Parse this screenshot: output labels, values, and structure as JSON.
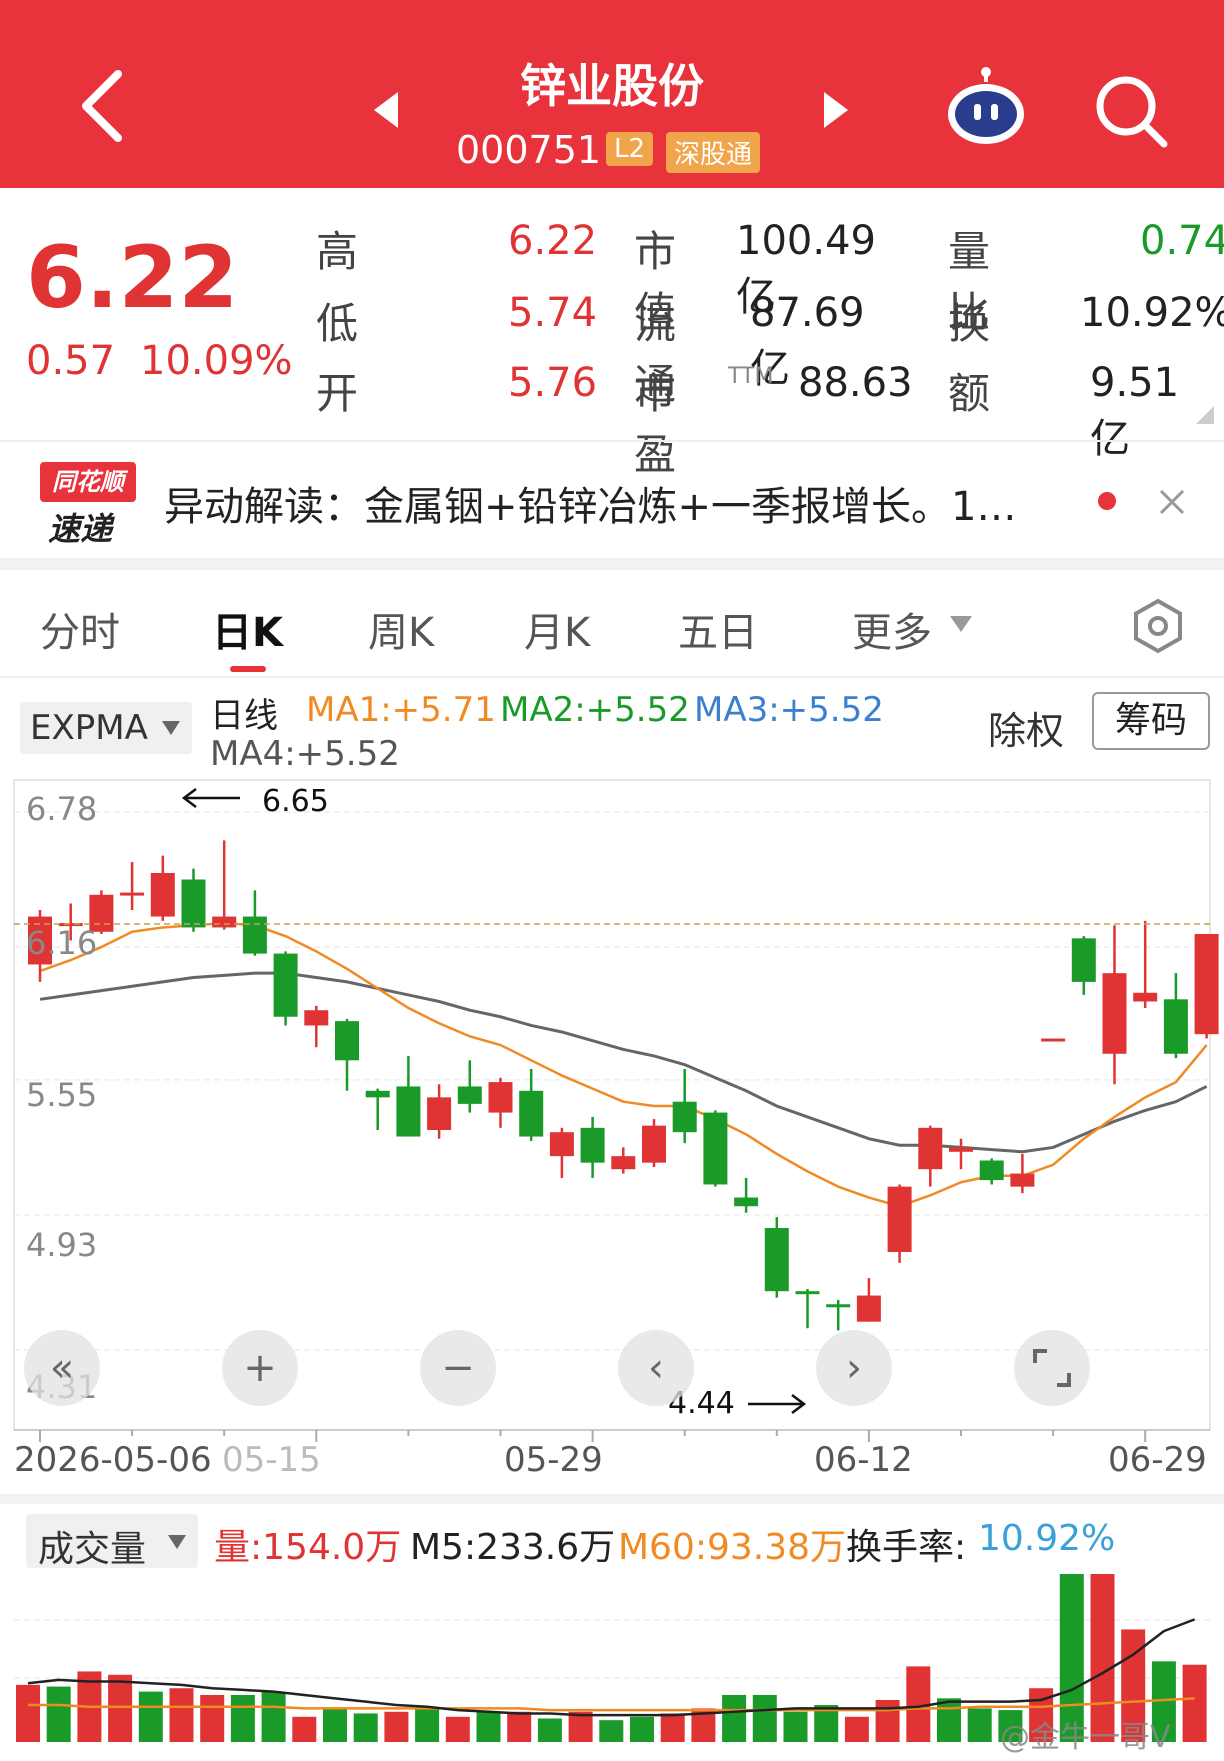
{
  "header": {
    "title": "锌业股份",
    "code": "000751",
    "badge_l2": "L2",
    "badge_connect": "深股通"
  },
  "quote": {
    "price": "6.22",
    "change": "0.57",
    "change_pct": "10.09%",
    "rows": [
      {
        "l1": "高",
        "v1": "6.22",
        "l2": "市值",
        "v2": "100.49亿",
        "l3": "量比",
        "v3": "0.74"
      },
      {
        "l1": "低",
        "v1": "5.74",
        "l2": "流通",
        "v2": "87.69亿",
        "l3": "换",
        "v3": "10.92%"
      },
      {
        "l1": "开",
        "v1": "5.76",
        "l2": "市盈",
        "v2": "88.63",
        "l3": "额",
        "v3": "9.51亿"
      }
    ],
    "pe_sup": "TTM"
  },
  "news": {
    "logo_top": "同花顺",
    "logo_bottom": "速递",
    "text": "异动解读：金属铟+铅锌冶炼+一季报增长。1…"
  },
  "tabs": [
    "分时",
    "日K",
    "周K",
    "月K",
    "五日",
    "更多"
  ],
  "active_tab": "日K",
  "indicator": {
    "selector": "EXPMA",
    "line_label": "日线",
    "ma1": "MA1:+5.71",
    "ma2": "MA2:+5.52",
    "ma3": "MA3:+5.52",
    "ma4": "MA4:+5.52",
    "exright": "除权",
    "chip": "筹码"
  },
  "annotations": {
    "high": "6.65",
    "low": "4.44"
  },
  "volume": {
    "selector": "成交量",
    "vol": "量:154.0万",
    "m5": "M5:233.6万",
    "m60": "M60:93.38万",
    "turnover_label": "换手率:",
    "turnover_value": "10.92%"
  },
  "watermark": "@金牛一哥V",
  "colors": {
    "header": "#e8323c",
    "up": "#e03434",
    "down": "#1a9a28",
    "ma1": "#f08a24",
    "ma2": "#1a9a28",
    "ma3": "#3a7fd0"
  },
  "chart_data": {
    "type": "candlestick",
    "ylim": [
      4.31,
      6.78
    ],
    "yticks": [
      "6.78",
      "6.16",
      "5.55",
      "4.93",
      "4.31"
    ],
    "xticks": [
      "2026-05-06",
      "05-15",
      "05-29",
      "06-12",
      "06-29"
    ],
    "candles": [
      {
        "o": 6.08,
        "c": 6.3,
        "h": 6.33,
        "l": 6.0
      },
      {
        "o": 6.26,
        "c": 6.27,
        "h": 6.36,
        "l": 6.19
      },
      {
        "o": 6.23,
        "c": 6.4,
        "h": 6.42,
        "l": 6.22
      },
      {
        "o": 6.4,
        "c": 6.41,
        "h": 6.55,
        "l": 6.33
      },
      {
        "o": 6.3,
        "c": 6.5,
        "h": 6.58,
        "l": 6.28
      },
      {
        "o": 6.47,
        "c": 6.25,
        "h": 6.52,
        "l": 6.23
      },
      {
        "o": 6.25,
        "c": 6.3,
        "h": 6.65,
        "l": 6.24
      },
      {
        "o": 6.3,
        "c": 6.13,
        "h": 6.42,
        "l": 6.12
      },
      {
        "o": 6.13,
        "c": 5.84,
        "h": 6.14,
        "l": 5.8
      },
      {
        "o": 5.8,
        "c": 5.87,
        "h": 5.89,
        "l": 5.7
      },
      {
        "o": 5.82,
        "c": 5.64,
        "h": 5.83,
        "l": 5.5
      },
      {
        "o": 5.5,
        "c": 5.47,
        "h": 5.51,
        "l": 5.32
      },
      {
        "o": 5.52,
        "c": 5.29,
        "h": 5.66,
        "l": 5.29
      },
      {
        "o": 5.32,
        "c": 5.47,
        "h": 5.53,
        "l": 5.28
      },
      {
        "o": 5.52,
        "c": 5.44,
        "h": 5.64,
        "l": 5.4
      },
      {
        "o": 5.4,
        "c": 5.54,
        "h": 5.56,
        "l": 5.33
      },
      {
        "o": 5.5,
        "c": 5.29,
        "h": 5.6,
        "l": 5.27
      },
      {
        "o": 5.2,
        "c": 5.31,
        "h": 5.33,
        "l": 5.1
      },
      {
        "o": 5.33,
        "c": 5.17,
        "h": 5.38,
        "l": 5.1
      },
      {
        "o": 5.14,
        "c": 5.2,
        "h": 5.24,
        "l": 5.12
      },
      {
        "o": 5.17,
        "c": 5.34,
        "h": 5.37,
        "l": 5.15
      },
      {
        "o": 5.45,
        "c": 5.31,
        "h": 5.6,
        "l": 5.26
      },
      {
        "o": 5.4,
        "c": 5.07,
        "h": 5.41,
        "l": 5.06
      },
      {
        "o": 5.01,
        "c": 4.97,
        "h": 5.1,
        "l": 4.94
      },
      {
        "o": 4.87,
        "c": 4.58,
        "h": 4.92,
        "l": 4.55
      },
      {
        "o": 4.58,
        "c": 4.57,
        "h": 4.59,
        "l": 4.41
      },
      {
        "o": 4.52,
        "c": 4.51,
        "h": 4.54,
        "l": 4.4
      },
      {
        "o": 4.44,
        "c": 4.56,
        "h": 4.64,
        "l": 4.44
      },
      {
        "o": 4.76,
        "c": 5.06,
        "h": 5.07,
        "l": 4.71
      },
      {
        "o": 5.14,
        "c": 5.33,
        "h": 5.34,
        "l": 5.06
      },
      {
        "o": 5.22,
        "c": 5.24,
        "h": 5.28,
        "l": 5.14
      },
      {
        "o": 5.18,
        "c": 5.09,
        "h": 5.19,
        "l": 5.07
      },
      {
        "o": 5.06,
        "c": 5.12,
        "h": 5.21,
        "l": 5.03
      },
      {
        "o": 5.73,
        "c": 5.74,
        "h": 5.74,
        "l": 5.73
      },
      {
        "o": 6.2,
        "c": 6.0,
        "h": 6.21,
        "l": 5.94
      },
      {
        "o": 5.67,
        "c": 6.04,
        "h": 6.26,
        "l": 5.53
      },
      {
        "o": 5.91,
        "c": 5.95,
        "h": 6.28,
        "l": 5.88
      },
      {
        "o": 5.92,
        "c": 5.67,
        "h": 6.04,
        "l": 5.65
      },
      {
        "o": 5.76,
        "c": 6.22,
        "h": 6.22,
        "l": 5.74
      }
    ],
    "ma1": [
      6.05,
      6.1,
      6.16,
      6.23,
      6.25,
      6.26,
      6.27,
      6.26,
      6.21,
      6.14,
      6.06,
      5.97,
      5.88,
      5.81,
      5.75,
      5.71,
      5.64,
      5.57,
      5.51,
      5.45,
      5.43,
      5.43,
      5.37,
      5.3,
      5.21,
      5.13,
      5.06,
      5.01,
      4.97,
      5.02,
      5.08,
      5.11,
      5.11,
      5.16,
      5.28,
      5.38,
      5.47,
      5.54,
      5.71
    ],
    "ma_long": [
      5.92,
      5.94,
      5.96,
      5.98,
      6.0,
      6.02,
      6.03,
      6.04,
      6.04,
      6.02,
      6.0,
      5.97,
      5.94,
      5.91,
      5.87,
      5.84,
      5.8,
      5.77,
      5.73,
      5.69,
      5.66,
      5.62,
      5.56,
      5.5,
      5.43,
      5.38,
      5.33,
      5.28,
      5.25,
      5.25,
      5.24,
      5.23,
      5.22,
      5.24,
      5.3,
      5.36,
      5.41,
      5.45,
      5.52
    ],
    "volume_max": 100,
    "volume": [
      34,
      33,
      42,
      40,
      30,
      32,
      28,
      28,
      30,
      15,
      20,
      17,
      18,
      20,
      15,
      18,
      18,
      14,
      18,
      13,
      15,
      17,
      20,
      28,
      28,
      18,
      22,
      15,
      25,
      45,
      26,
      20,
      19,
      32,
      100,
      100,
      67,
      48,
      46
    ],
    "volume_up": [
      true,
      false,
      true,
      true,
      false,
      true,
      true,
      false,
      false,
      true,
      false,
      false,
      true,
      false,
      true,
      false,
      true,
      false,
      true,
      false,
      false,
      true,
      true,
      false,
      false,
      false,
      false,
      true,
      true,
      true,
      false,
      false,
      false,
      true,
      false,
      true,
      true,
      false,
      true
    ],
    "m60": [
      22,
      22,
      21,
      21,
      21,
      21,
      21,
      21,
      21,
      20,
      20,
      20,
      20,
      20,
      20,
      20,
      20,
      19,
      19,
      19,
      19,
      19,
      19,
      19,
      19,
      19,
      19,
      19,
      19,
      20,
      20,
      21,
      21,
      21,
      22,
      23,
      24,
      25,
      26
    ],
    "m5": [
      35,
      37,
      36,
      36,
      35,
      34,
      32,
      31,
      30,
      28,
      26,
      24,
      22,
      21,
      19,
      18,
      17,
      17,
      16,
      16,
      16,
      16,
      17,
      18,
      19,
      20,
      20,
      20,
      20,
      21,
      24,
      24,
      24,
      25,
      31,
      41,
      52,
      66,
      73
    ]
  }
}
